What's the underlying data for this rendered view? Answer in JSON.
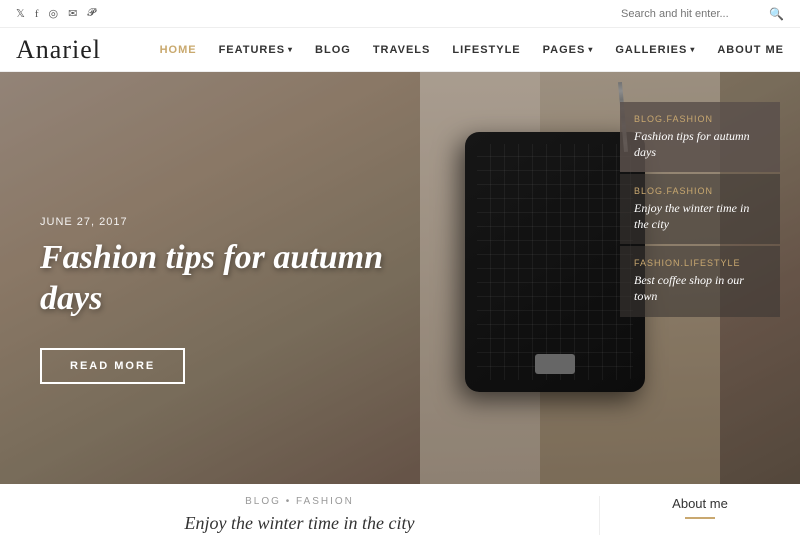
{
  "topbar": {
    "search_placeholder": "Search and hit enter...",
    "social_icons": [
      "twitter",
      "facebook",
      "instagram",
      "email",
      "pinterest"
    ]
  },
  "header": {
    "logo": "Anariel",
    "nav_items": [
      {
        "label": "HOME",
        "active": true,
        "has_arrow": false
      },
      {
        "label": "FEATURES",
        "active": false,
        "has_arrow": true
      },
      {
        "label": "BLOG",
        "active": false,
        "has_arrow": false
      },
      {
        "label": "TRAVELS",
        "active": false,
        "has_arrow": false
      },
      {
        "label": "LIFESTYLE",
        "active": false,
        "has_arrow": false
      },
      {
        "label": "PAGES",
        "active": false,
        "has_arrow": true
      },
      {
        "label": "GALLERIES",
        "active": false,
        "has_arrow": true
      },
      {
        "label": "ABOUT ME",
        "active": false,
        "has_arrow": false
      }
    ]
  },
  "hero": {
    "date": "JUNE 27, 2017",
    "title": "Fashion tips for autumn days",
    "read_more_label": "READ MORE",
    "sidebar_cards": [
      {
        "category": "BLOG.FASHION",
        "title": "Fashion tips for autumn days",
        "active": true
      },
      {
        "category": "BLOG.FASHION",
        "title": "Enjoy the winter time in the city",
        "active": false
      },
      {
        "category": "FASHION.LIFESTYLE",
        "title": "Best coffee shop in our town",
        "active": false
      }
    ]
  },
  "bottom": {
    "article_category": "BLOG • FASHION",
    "article_title": "Enjoy the winter time in the city",
    "about_label": "About me"
  }
}
